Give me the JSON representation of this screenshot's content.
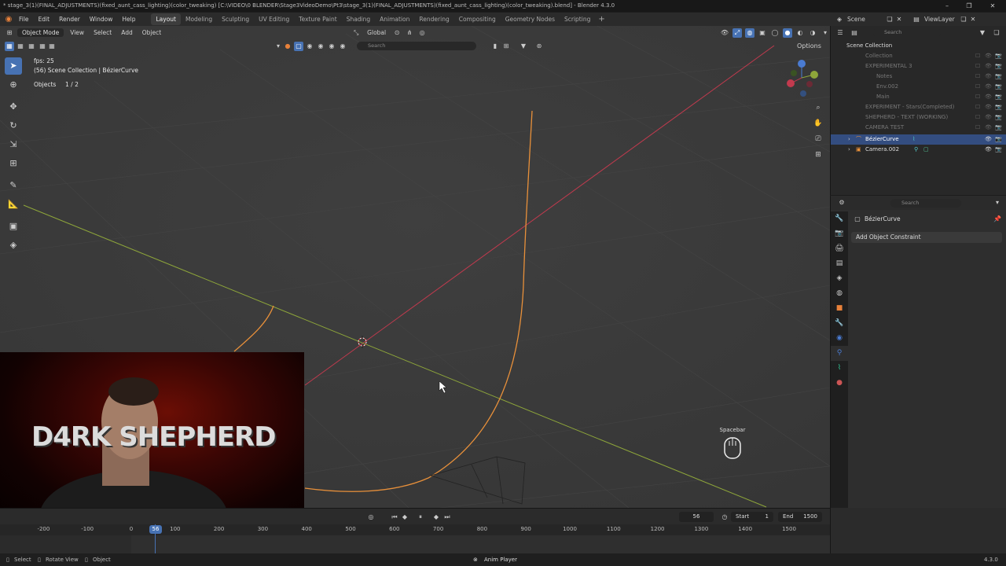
{
  "window": {
    "title": "* stage_3(1)(FINAL_ADJUSTMENTS)(fixed_aunt_cass_lighting)(color_tweaking) [C:\\VIDEO\\0 BLENDER\\Stage3VideoDemo\\Pt3\\stage_3(1)(FINAL_ADJUSTMENTS)(fixed_aunt_cass_lighting)(color_tweaking).blend] - Blender 4.3.0",
    "minimize": "–",
    "maximize": "❐",
    "close": "✕"
  },
  "menu": [
    "File",
    "Edit",
    "Render",
    "Window",
    "Help"
  ],
  "workspaces": [
    "Layout",
    "Modeling",
    "Sculpting",
    "UV Editing",
    "Texture Paint",
    "Shading",
    "Animation",
    "Rendering",
    "Compositing",
    "Geometry Nodes",
    "Scripting"
  ],
  "active_workspace": "Layout",
  "scene": {
    "scene_name": "Scene",
    "view_layer": "ViewLayer"
  },
  "viewport": {
    "mode": "Object Mode",
    "menus": [
      "View",
      "Select",
      "Add",
      "Object"
    ],
    "orientation": "Global",
    "search_placeholder": "Search",
    "options_label": "Options",
    "fps": "fps: 25",
    "context": "(56) Scene Collection | BézierCurve",
    "objects_label": "Objects",
    "objects_value": "1 / 2",
    "key_hint": "Spacebar"
  },
  "webcam": {
    "brand_text": "D4RK SHEPHERD"
  },
  "outliner": {
    "search_placeholder": "Search",
    "root": "Scene Collection",
    "rows": [
      {
        "label": "Collection",
        "dim": true
      },
      {
        "label": "EXPERIMENTAL 3",
        "dim": true
      },
      {
        "label": "Notes",
        "dim": true
      },
      {
        "label": "Env.002",
        "dim": true
      },
      {
        "label": "Main",
        "dim": true
      },
      {
        "label": "EXPERIMENT - Stars(Completed)",
        "dim": true
      },
      {
        "label": "SHEPHERD - TEXT (WORKING)",
        "dim": true
      },
      {
        "label": "CAMERA TEST",
        "dim": true
      },
      {
        "label": "BézierCurve",
        "dim": false,
        "selected": true
      },
      {
        "label": "Camera.002",
        "dim": false
      }
    ]
  },
  "properties": {
    "search_placeholder": "Search",
    "object_name": "BézierCurve",
    "add_constraint": "Add Object Constraint"
  },
  "timeline": {
    "current_frame": "56",
    "start_label": "Start",
    "start_value": "1",
    "end_label": "End",
    "end_value": "1500",
    "ticks": [
      "-200",
      "-100",
      "0",
      "100",
      "200",
      "300",
      "400",
      "500",
      "600",
      "700",
      "800",
      "900",
      "1000",
      "1100",
      "1200",
      "1300",
      "1400",
      "1500"
    ]
  },
  "status": {
    "select": "Select",
    "rotate": "Rotate View",
    "object": "Object",
    "anim_player": "Anim Player",
    "version": "4.3.0"
  },
  "colors": {
    "accent": "#4772b3",
    "curve": "#e8903a",
    "x_axis": "#c23a4e",
    "y_axis": "#8ea63a",
    "selected_row": "#334d80"
  }
}
